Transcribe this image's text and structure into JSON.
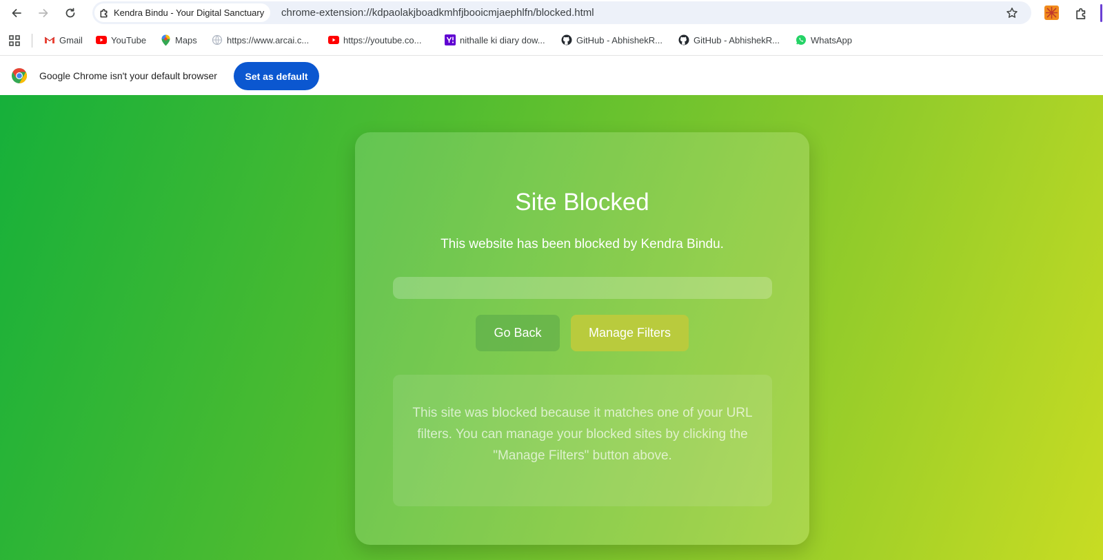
{
  "toolbar": {
    "tab_chip_title": "Kendra Bindu - Your Digital Sanctuary",
    "url": "chrome-extension://kdpaolakjboadkmhfjbooicmjaephlfn/blocked.html"
  },
  "bookmarks": [
    {
      "label": "Gmail",
      "icon": "gmail-icon"
    },
    {
      "label": "YouTube",
      "icon": "youtube-icon"
    },
    {
      "label": "Maps",
      "icon": "maps-icon"
    },
    {
      "label": "https://www.arcai.c...",
      "icon": "globe-icon"
    },
    {
      "label": "https://youtube.co...",
      "icon": "youtube-icon"
    },
    {
      "label": "nithalle ki diary dow...",
      "icon": "yahoo-icon"
    },
    {
      "label": "GitHub - AbhishekR...",
      "icon": "github-icon"
    },
    {
      "label": "GitHub - AbhishekR...",
      "icon": "github-icon"
    },
    {
      "label": "WhatsApp",
      "icon": "whatsapp-icon"
    }
  ],
  "infobar": {
    "message": "Google Chrome isn't your default browser",
    "button_label": "Set as default"
  },
  "blocked_page": {
    "title": "Site Blocked",
    "subtitle": "This website has been blocked by Kendra Bindu.",
    "blocked_url": "",
    "go_back_label": "Go Back",
    "manage_filters_label": "Manage Filters",
    "note": "This site was blocked because it matches one of your URL filters. You can manage your blocked sites by clicking the \"Manage Filters\" button above."
  },
  "colors": {
    "gradient_start": "#16b03a",
    "gradient_end": "#c8dc23",
    "manage_filters_bg": "#b9cb3d",
    "set_default_bg": "#0b57d0"
  }
}
